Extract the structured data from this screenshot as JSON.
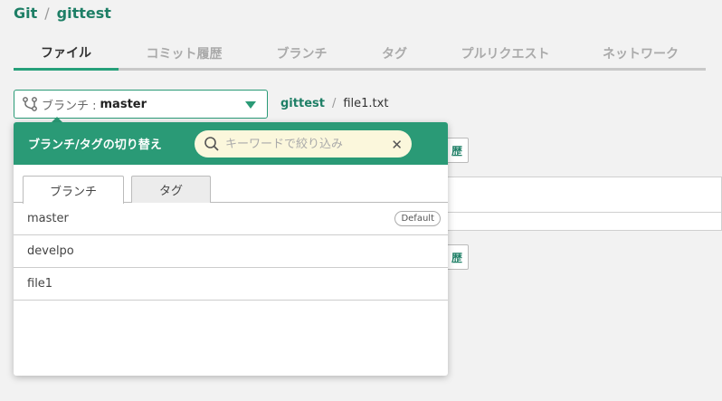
{
  "breadcrumb": {
    "root": "Git",
    "separator": "/",
    "repo": "gittest"
  },
  "tabs": [
    {
      "label": "ファイル"
    },
    {
      "label": "コミット履歴"
    },
    {
      "label": "ブランチ"
    },
    {
      "label": "タグ"
    },
    {
      "label": "プルリクエスト"
    },
    {
      "label": "ネットワーク"
    }
  ],
  "branch_selector": {
    "label": "ブランチ :",
    "value": "master"
  },
  "path": {
    "repo": "gittest",
    "separator": "/",
    "file": "file1.txt"
  },
  "background": {
    "button_label": "歴"
  },
  "popup": {
    "title": "ブランチ/タグの切り替え",
    "search": {
      "placeholder": "キーワードで絞り込み",
      "value": ""
    },
    "subtabs": [
      {
        "label": "ブランチ"
      },
      {
        "label": "タグ"
      }
    ],
    "items": [
      {
        "label": "master",
        "badge": "Default"
      },
      {
        "label": "develpo",
        "badge": ""
      },
      {
        "label": "file1",
        "badge": ""
      }
    ]
  },
  "colors": {
    "accent": "#2a9a76",
    "link": "#1e7f66",
    "search_bg": "#fbf7dc"
  }
}
